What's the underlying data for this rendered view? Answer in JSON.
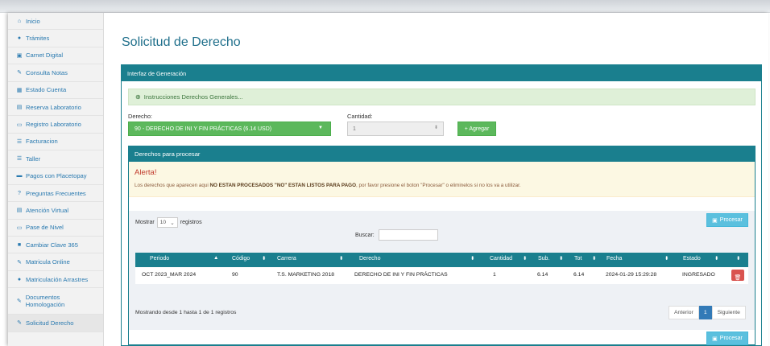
{
  "sidebar": {
    "items": [
      {
        "icon": "home-icon",
        "glyph": "⌂",
        "label": "Inicio"
      },
      {
        "icon": "people-icon",
        "glyph": "●",
        "label": "Trámites"
      },
      {
        "icon": "card-icon",
        "glyph": "▣",
        "label": "Carnet Digital"
      },
      {
        "icon": "pencil-icon",
        "glyph": "✎",
        "label": "Consulta Notas"
      },
      {
        "icon": "building-icon",
        "glyph": "▦",
        "label": "Estado Cuenta"
      },
      {
        "icon": "calendar-icon",
        "glyph": "▤",
        "label": "Reserva Laboratorio"
      },
      {
        "icon": "laptop-icon",
        "glyph": "▭",
        "label": "Registro Laboratorio"
      },
      {
        "icon": "list-icon",
        "glyph": "☰",
        "label": "Facturacion"
      },
      {
        "icon": "list-icon",
        "glyph": "☰",
        "label": "Taller"
      },
      {
        "icon": "card-icon",
        "glyph": "▬",
        "label": "Pagos con Placetopay"
      },
      {
        "icon": "question-icon",
        "glyph": "?",
        "label": "Preguntas Frecuentes"
      },
      {
        "icon": "calendar-icon",
        "glyph": "▤",
        "label": "Atención Virtual"
      },
      {
        "icon": "ticket-icon",
        "glyph": "▭",
        "label": "Pase de Nivel"
      },
      {
        "icon": "briefcase-icon",
        "glyph": "■",
        "label": "Cambiar Clave 365"
      },
      {
        "icon": "edit-icon",
        "glyph": "✎",
        "label": "Matricula Online"
      },
      {
        "icon": "group-icon",
        "glyph": "●",
        "label": "Matriculación Arrastres"
      },
      {
        "icon": "edit-icon",
        "glyph": "✎",
        "label": "Documentos Homologación"
      },
      {
        "icon": "edit-icon",
        "glyph": "✎",
        "label": "Solicitud Derecho"
      }
    ]
  },
  "page_title": "Solicitud de Derecho",
  "panel": {
    "title": "Interfaz de Generación",
    "instructions": "Instrucciones Derechos Generales...",
    "derecho_label": "Derecho:",
    "derecho_value": "90 - DERECHO DE INI Y FIN PRÁCTICAS   (6.14 USD)",
    "cantidad_label": "Cantidad:",
    "cantidad_value": "1",
    "agregar_label": "+ Agregar"
  },
  "subpanel": {
    "title": "Derechos para procesar",
    "alert_title": "Alerta!",
    "alert_text_1": "Los derechos que aparecen aqui ",
    "alert_text_bold": "NO ESTAN PROCESADOS \"NO\" ESTAN LISTOS PARA PAGO",
    "alert_text_2": ", por favor presione el boton \"Procesar\" o eliminelos si no los va a utilizar."
  },
  "table": {
    "show_label": "Mostrar",
    "length_value": "10",
    "records_label": "registros",
    "search_label": "Buscar:",
    "process_label": "Procesar",
    "columns": [
      "Periodo",
      "Código",
      "Carrera",
      "Derecho",
      "Cantidad",
      "Sub.",
      "Tot",
      "Fecha",
      "Estado"
    ],
    "rows": [
      {
        "periodo": "OCT 2023_MAR 2024",
        "codigo": "90",
        "carrera": "T.S. MARKETING 2018",
        "derecho": "DERECHO DE INI Y FIN PRÁCTICAS",
        "cantidad": "1",
        "sub": "6.14",
        "tot": "6.14",
        "fecha": "2024-01-29 15:29:28",
        "estado": "INGRESADO"
      }
    ],
    "info": "Mostrando desde 1 hasta 1 de 1 registros",
    "prev_label": "Anterior",
    "current_page": "1",
    "next_label": "Siguiente"
  }
}
